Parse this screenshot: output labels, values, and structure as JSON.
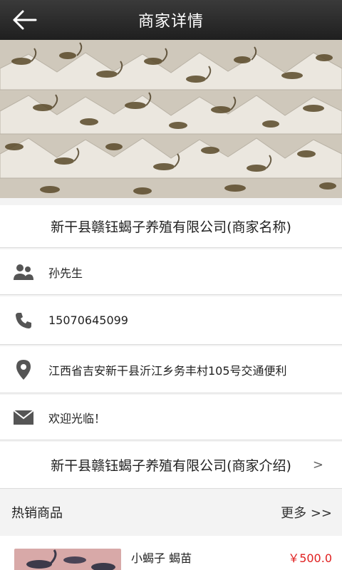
{
  "header": {
    "title": "商家详情",
    "back_icon": "back-arrow-icon"
  },
  "merchant": {
    "name": "新干县赣钰蝎子养殖有限公司(商家名称)",
    "contact": "孙先生",
    "phone": "15070645099",
    "address": "江西省吉安新干县沂江乡务丰村105号交通便利",
    "message": "欢迎光临！",
    "intro": "新干县赣钰蝎子养殖有限公司(商家介绍)",
    "intro_chevron": ">"
  },
  "hot": {
    "title": "热销商品",
    "more": "更多 >>"
  },
  "products": [
    {
      "name": "小蝎子 蝎苗",
      "price": "￥500.0"
    }
  ],
  "colors": {
    "header_bg": "#2b2b2b",
    "price": "#e02020",
    "icon": "#555555"
  }
}
